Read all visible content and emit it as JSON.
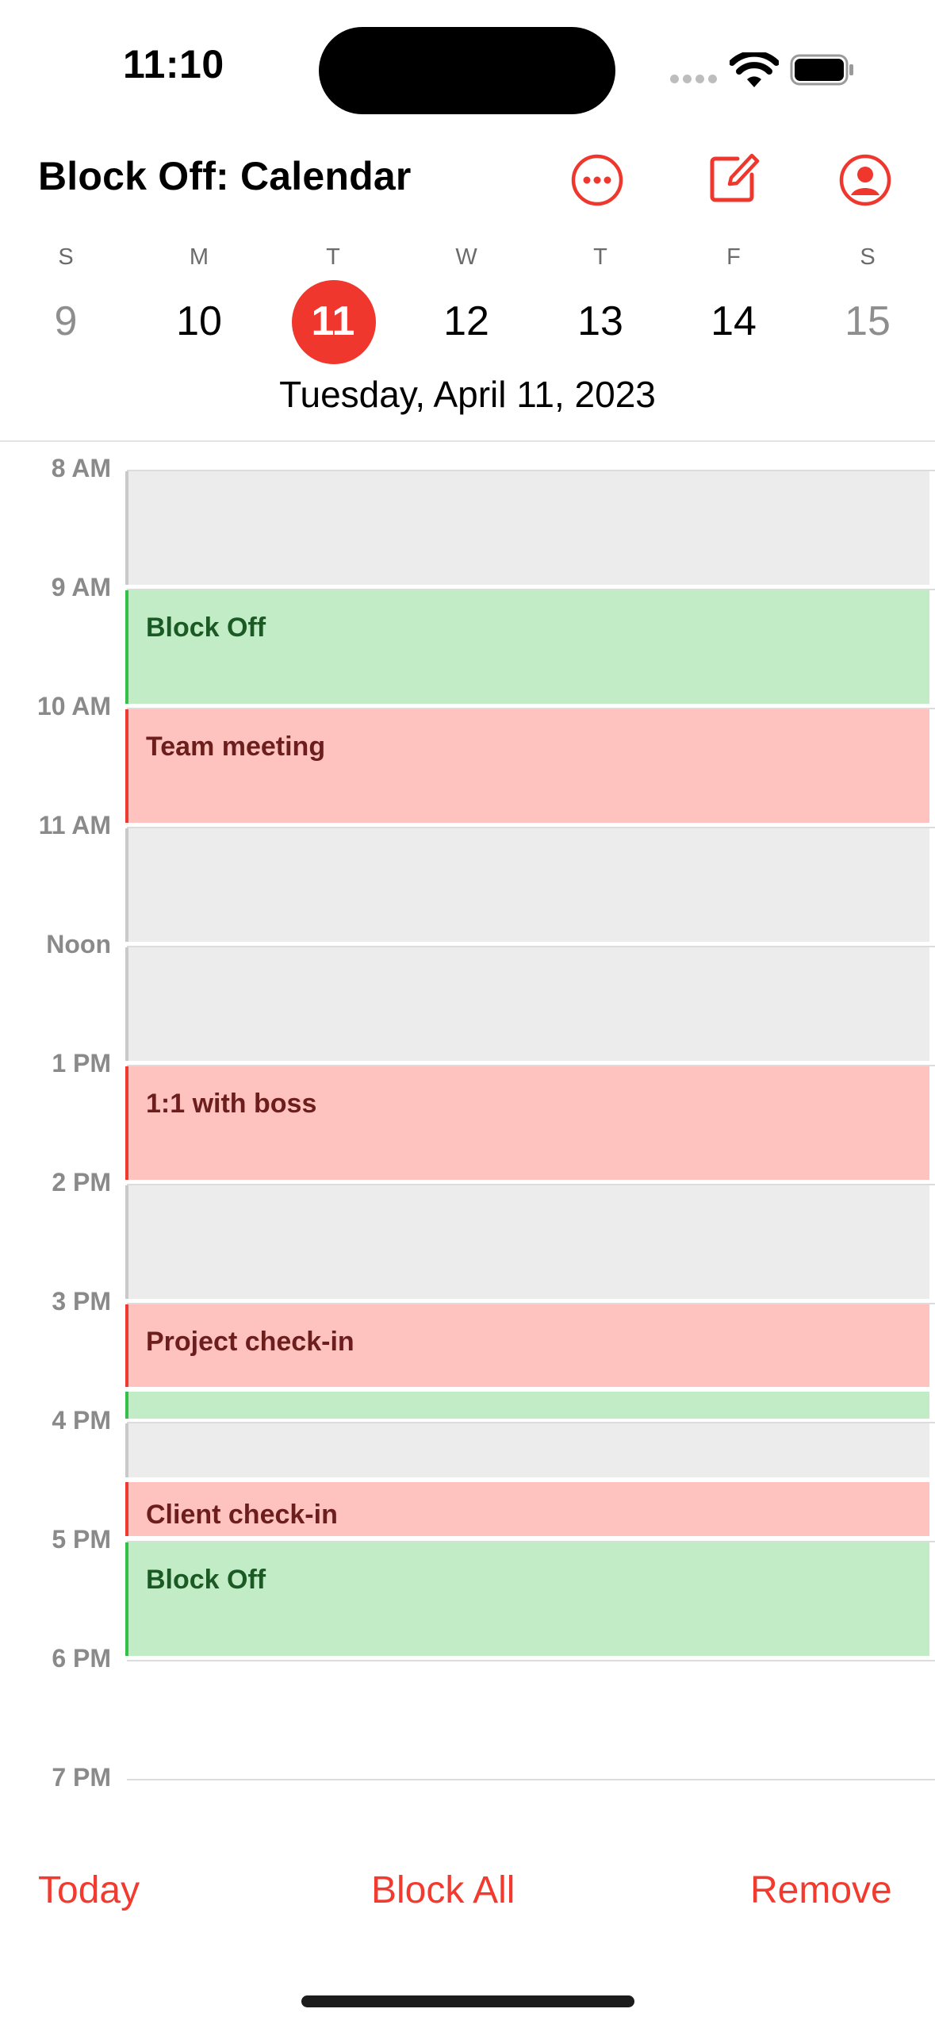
{
  "status_bar": {
    "time": "11:10"
  },
  "header": {
    "title": "Block Off: Calendar",
    "icons": {
      "more": "ellipsis-circle-icon",
      "compose": "compose-icon",
      "profile": "person-circle-icon"
    },
    "accent_color": "#f0372d"
  },
  "week": {
    "days": [
      {
        "dow": "S",
        "day": "9"
      },
      {
        "dow": "M",
        "day": "10"
      },
      {
        "dow": "T",
        "day": "11"
      },
      {
        "dow": "W",
        "day": "12"
      },
      {
        "dow": "T",
        "day": "13"
      },
      {
        "dow": "F",
        "day": "14"
      },
      {
        "dow": "S",
        "day": "15"
      }
    ],
    "selected_index": 2,
    "selected_date": "Tuesday, April 11, 2023"
  },
  "timeline": {
    "hours": [
      "8 AM",
      "9 AM",
      "10 AM",
      "11 AM",
      "Noon",
      "1 PM",
      "2 PM",
      "3 PM",
      "4 PM",
      "5 PM",
      "6 PM",
      "7 PM"
    ],
    "events": [
      {
        "title": "Block Off",
        "kind": "block-off",
        "color": "#c1ecc6"
      },
      {
        "title": "Team meeting",
        "kind": "meeting",
        "color": "#fec2bf"
      },
      {
        "title": "1:1 with boss",
        "kind": "meeting",
        "color": "#fec2bf"
      },
      {
        "title": "Project check-in",
        "kind": "meeting",
        "color": "#fec2bf"
      },
      {
        "title": "Client check-in",
        "kind": "meeting",
        "color": "#fec2bf"
      },
      {
        "title": "Block Off",
        "kind": "block-off",
        "color": "#c1ecc6"
      }
    ]
  },
  "toolbar": {
    "today": "Today",
    "block_all": "Block All",
    "remove": "Remove"
  }
}
